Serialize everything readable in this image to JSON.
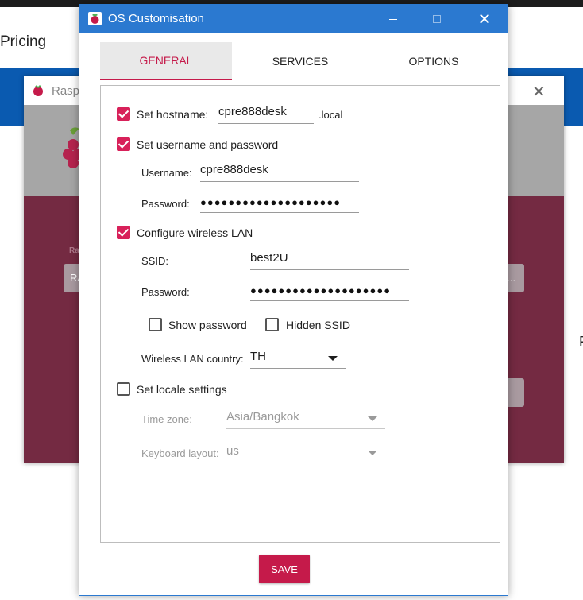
{
  "background": {
    "pricing_text": "Pricing",
    "right_edge_text": "F",
    "imager": {
      "title_fragment": "Raspb",
      "close_glyph": "✕",
      "label_fragment": "Ra",
      "button_left_fragment": "RA",
      "button_right_fragment": "B ..."
    }
  },
  "dialog": {
    "title": "OS Customisation",
    "minimize_glyph": "—",
    "close_glyph": "✕",
    "tabs": [
      {
        "label": "GENERAL",
        "active": true
      },
      {
        "label": "SERVICES",
        "active": false
      },
      {
        "label": "OPTIONS",
        "active": false
      }
    ],
    "general": {
      "hostname": {
        "label": "Set hostname:",
        "checked": true,
        "value": "cpre888desk",
        "suffix": ".local"
      },
      "userpass": {
        "label": "Set username and password",
        "checked": true,
        "username_label": "Username:",
        "username_value": "cpre888desk",
        "password_label": "Password:",
        "password_value": "●●●●●●●●●●●●●●●●●●●●"
      },
      "wlan": {
        "label": "Configure wireless LAN",
        "checked": true,
        "ssid_label": "SSID:",
        "ssid_value": "best2U",
        "password_label": "Password:",
        "password_value": "●●●●●●●●●●●●●●●●●●●●",
        "show_password_label": "Show password",
        "show_password_checked": false,
        "hidden_ssid_label": "Hidden SSID",
        "hidden_ssid_checked": false,
        "country_label": "Wireless LAN country:",
        "country_value": "TH"
      },
      "locale": {
        "label": "Set locale settings",
        "checked": false,
        "timezone_label": "Time zone:",
        "timezone_value": "Asia/Bangkok",
        "keyboard_label": "Keyboard layout:",
        "keyboard_value": "us"
      }
    },
    "save_label": "SAVE"
  },
  "colors": {
    "accent": "#c51a4a",
    "checkbox": "#d8215a",
    "titlebar": "#2b79d0",
    "imager_body": "#742a42"
  }
}
